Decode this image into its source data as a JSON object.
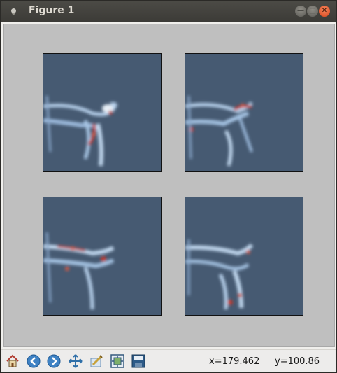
{
  "window": {
    "title": "Figure 1"
  },
  "figure": {
    "panels": [
      {
        "id": "top-left"
      },
      {
        "id": "top-right"
      },
      {
        "id": "bottom-left"
      },
      {
        "id": "bottom-right"
      }
    ],
    "colormap": "seismic-like, background #465a72"
  },
  "toolbar": {
    "buttons": [
      "home-icon",
      "back-icon",
      "forward-icon",
      "pan-icon",
      "configure-subplots-icon",
      "zoom-icon",
      "save-icon"
    ]
  },
  "status": {
    "x_readout": "x=179.462",
    "y_readout": "y=100.86"
  }
}
